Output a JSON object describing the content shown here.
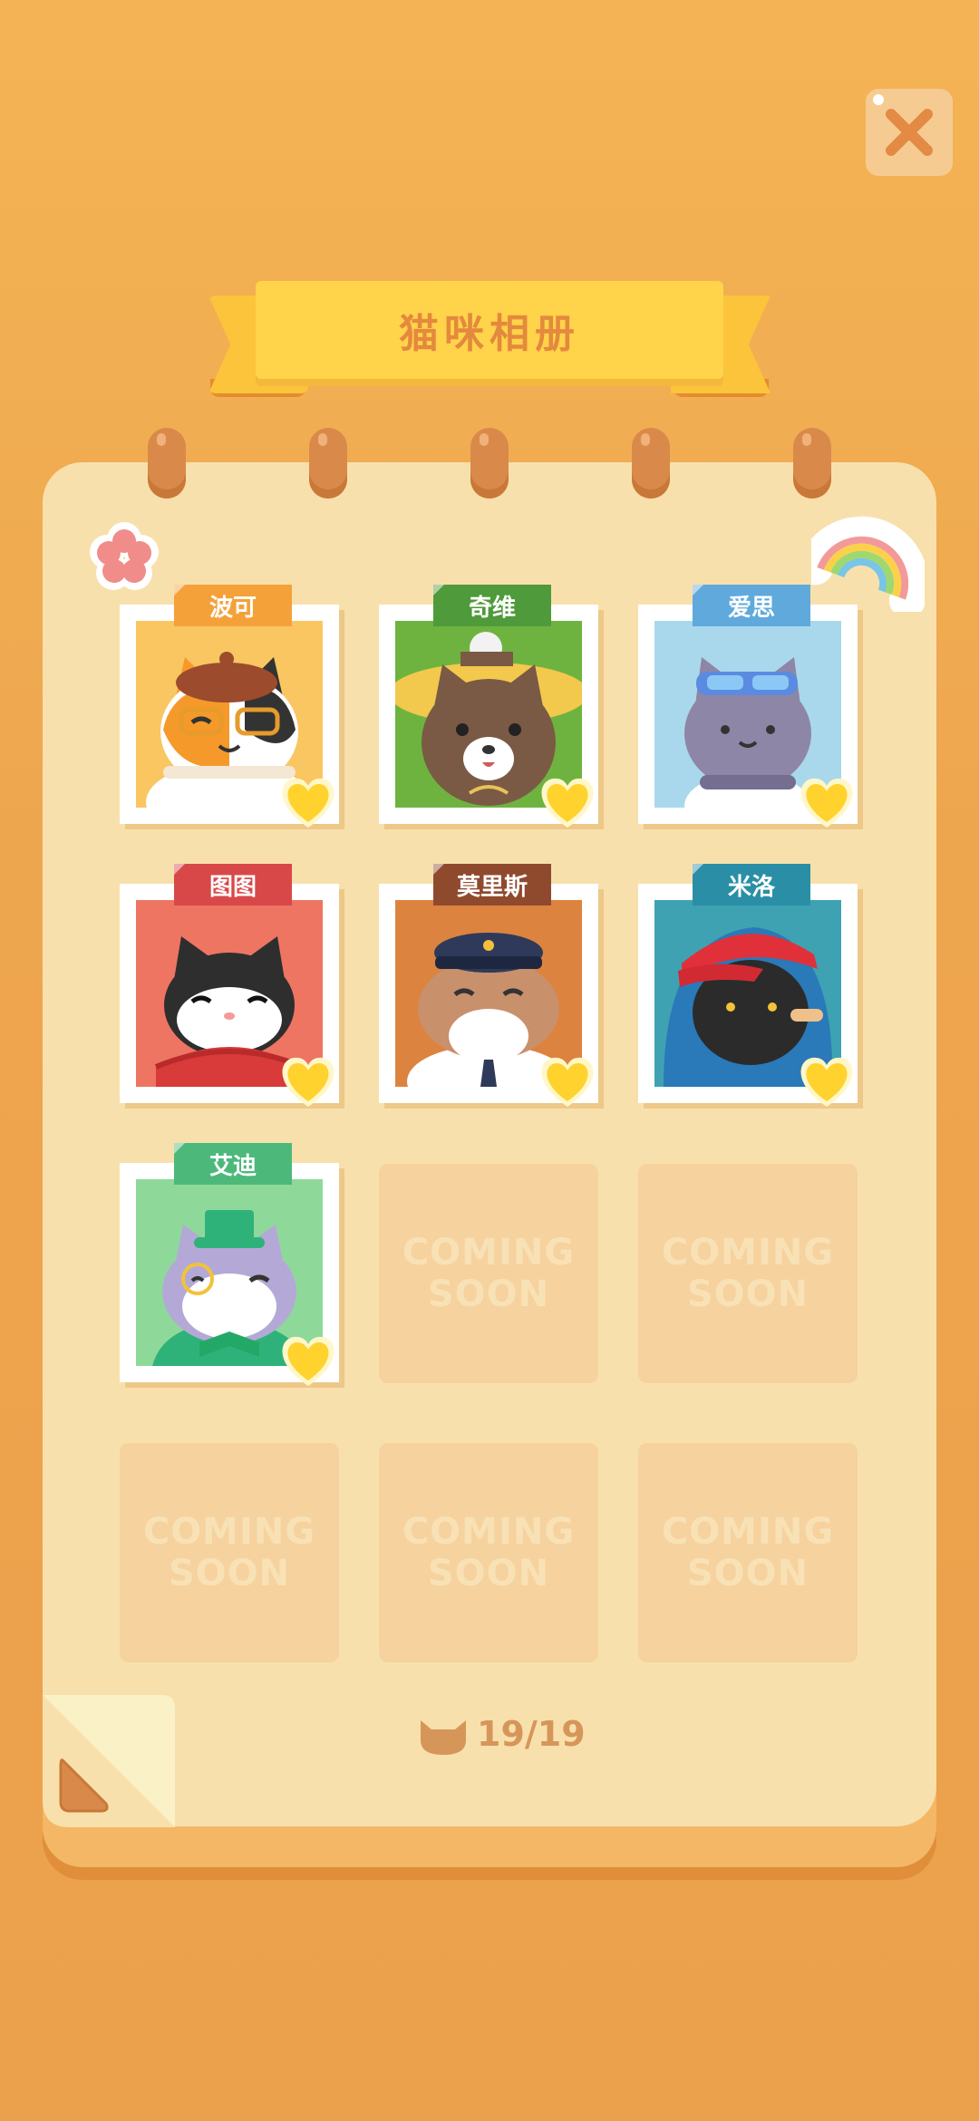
{
  "header": {
    "title": "猫咪相册"
  },
  "cats": [
    {
      "name": "波可",
      "tag_color": "#F5A13A",
      "bg": "#F9C661"
    },
    {
      "name": "奇维",
      "tag_color": "#4F9A3A",
      "bg": "#6EB33F"
    },
    {
      "name": "爱思",
      "tag_color": "#5FA9DD",
      "bg": "#A9D8EC"
    },
    {
      "name": "图图",
      "tag_color": "#D94848",
      "bg": "#EE7562"
    },
    {
      "name": "莫里斯",
      "tag_color": "#8F4A2E",
      "bg": "#DD8340"
    },
    {
      "name": "米洛",
      "tag_color": "#2A8FA6",
      "bg": "#3EA2B3"
    },
    {
      "name": "艾迪",
      "tag_color": "#4CB97A",
      "bg": "#8ED99A"
    }
  ],
  "coming_soon": {
    "line1": "COMING",
    "line2": "SOON"
  },
  "footer": {
    "counter": "19/19"
  }
}
